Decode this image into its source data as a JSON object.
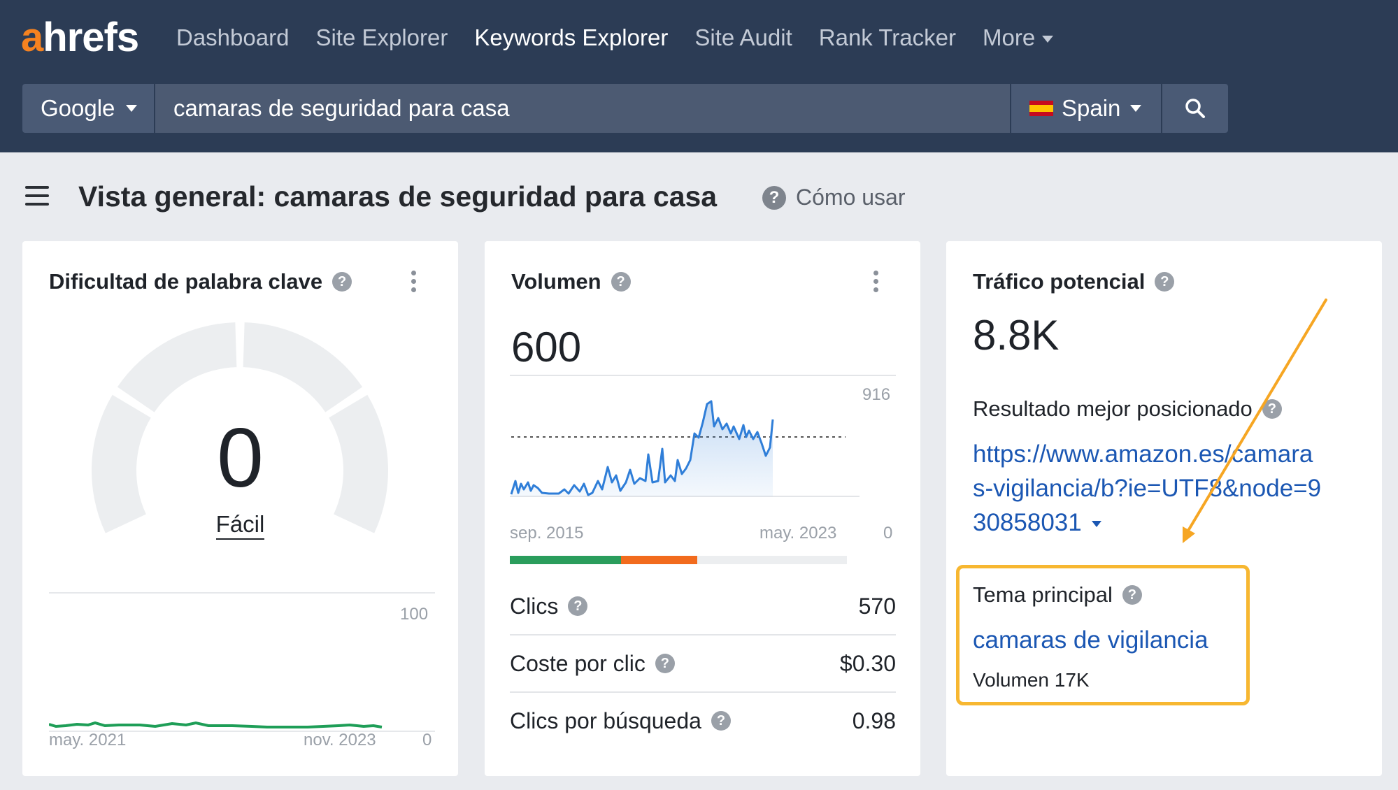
{
  "brand": {
    "logo_a": "a",
    "logo_rest": "hrefs"
  },
  "nav": {
    "items": [
      {
        "label": "Dashboard",
        "active": false
      },
      {
        "label": "Site Explorer",
        "active": false
      },
      {
        "label": "Keywords Explorer",
        "active": true
      },
      {
        "label": "Site Audit",
        "active": false
      },
      {
        "label": "Rank Tracker",
        "active": false
      },
      {
        "label": "More",
        "active": false
      }
    ]
  },
  "search": {
    "engine": "Google",
    "query": "camaras de seguridad para casa",
    "country": "Spain"
  },
  "header": {
    "title": "Vista general: camaras de seguridad para casa",
    "how_to": "Cómo usar"
  },
  "kd_card": {
    "title": "Dificultad de palabra clave",
    "value": "0",
    "label": "Fácil",
    "gauge_level": 0,
    "chart": {
      "y_max": "100",
      "y_min": "0",
      "x_start": "may. 2021",
      "x_end": "nov. 2023"
    }
  },
  "volume_card": {
    "title": "Volumen",
    "value": "600",
    "chart": {
      "y_max": "916",
      "y_min": "0",
      "x_start": "sep. 2015",
      "x_end": "may. 2023"
    },
    "split_bar": [
      {
        "color": "#2a9d5c",
        "fraction": 0.33
      },
      {
        "color": "#f26b1d",
        "fraction": 0.225
      },
      {
        "color": "#eceef0",
        "fraction": 0.445
      }
    ],
    "metrics": [
      {
        "label": "Clics",
        "value": "570"
      },
      {
        "label": "Coste por clic",
        "value": "$0.30"
      },
      {
        "label": "Clics por búsqueda",
        "value": "0.98"
      }
    ]
  },
  "traffic_card": {
    "title": "Tráfico potencial",
    "value": "8.8K",
    "top_result_label": "Resultado mejor posicionado",
    "top_result_url_lines": [
      "https://www.amazon.es/camara",
      "s-vigilancia/b?ie=UTF8&node=9",
      "30858031"
    ],
    "parent_topic_label": "Tema principal",
    "parent_topic": "camaras de vigilancia",
    "parent_topic_volume": "Volumen 17K"
  },
  "colors": {
    "topbar": "#2c3c55",
    "accent_orange": "#f58220",
    "link_blue": "#1b57b3",
    "chart_blue": "#2f7ed8",
    "kd_green": "#1e9e57",
    "highlight": "#f7b731"
  }
}
